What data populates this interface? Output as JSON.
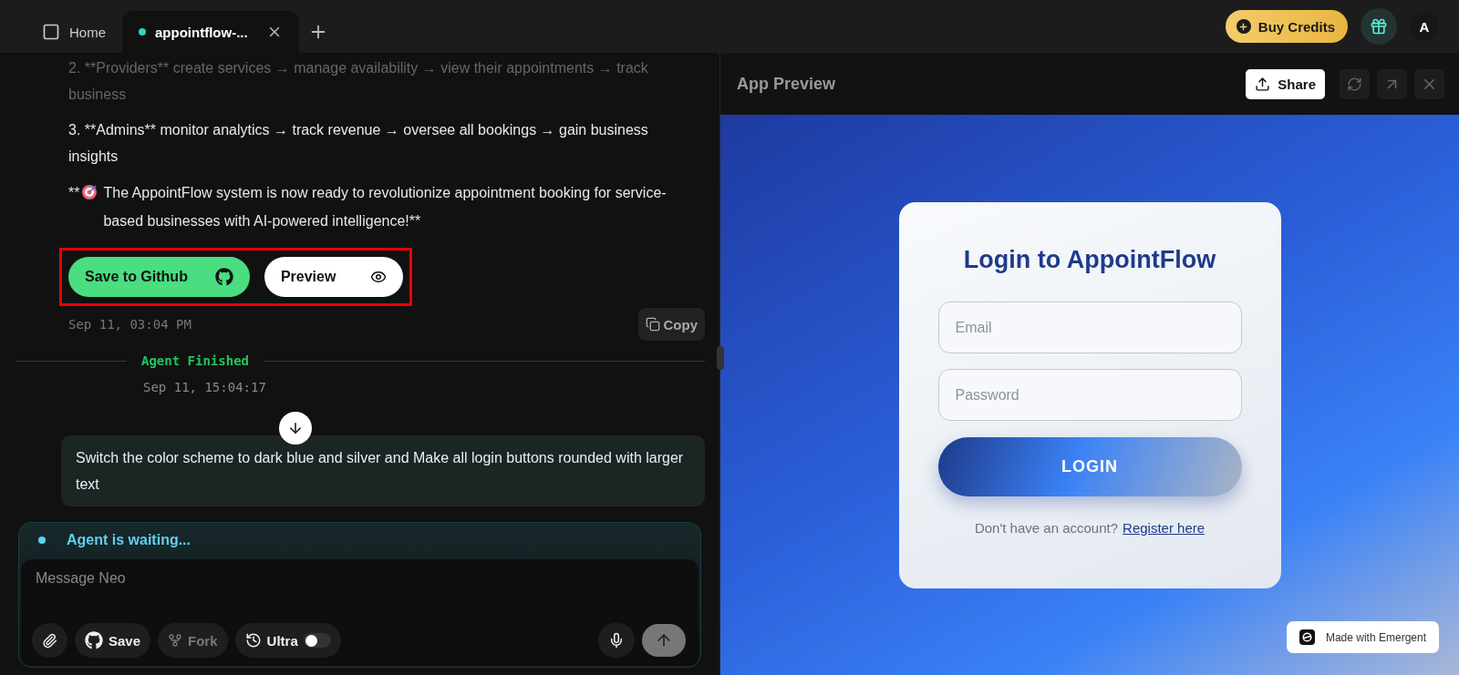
{
  "tabs": [
    {
      "kind": "home",
      "label": "Home",
      "selected": false
    },
    {
      "kind": "project",
      "label": "appointflow-...",
      "selected": true
    }
  ],
  "account": {
    "buy_credits": "Buy Credits",
    "avatar": "A"
  },
  "chat": {
    "paragraphs": [
      {
        "text": "2. **Providers** create services → manage availability → view their appointments → track business",
        "faded": true
      },
      {
        "text": "3. **Admins** monitor analytics → track revenue → oversee all bookings → gain business insights",
        "faded": false
      }
    ],
    "closing": {
      "prefix": "**",
      "text": "The AppointFlow system is now ready to revolutionize appointment booking for service-based businesses with AI-powered intelligence!**"
    },
    "action_buttons": [
      {
        "kind": "github",
        "label": "Save to Github"
      },
      {
        "kind": "preview",
        "label": "Preview"
      }
    ],
    "timestamp": "Sep 11, 03:04 PM",
    "copy": "Copy",
    "status": {
      "label": "Agent Finished",
      "time": "Sep 11, 15:04:17"
    },
    "user_message": "Switch the color scheme to dark blue and silver and Make all login buttons rounded with larger text"
  },
  "composer": {
    "status": "Agent is waiting...",
    "placeholder": "Message Neo",
    "tools": [
      {
        "kind": "attach",
        "disabled": false
      },
      {
        "kind": "save",
        "label": "Save",
        "disabled": false
      },
      {
        "kind": "fork",
        "label": "Fork",
        "disabled": true
      },
      {
        "kind": "ultra",
        "label": "Ultra",
        "disabled": false,
        "on": false
      }
    ],
    "send_disabled": true
  },
  "preview": {
    "title": "App Preview",
    "share": "Share",
    "login": {
      "title": "Login to AppointFlow",
      "email_placeholder": "Email",
      "password_placeholder": "Password",
      "button": "LOGIN",
      "prompt": "Don't have an account?",
      "link": "Register here"
    },
    "badge": "Made with Emergent"
  }
}
